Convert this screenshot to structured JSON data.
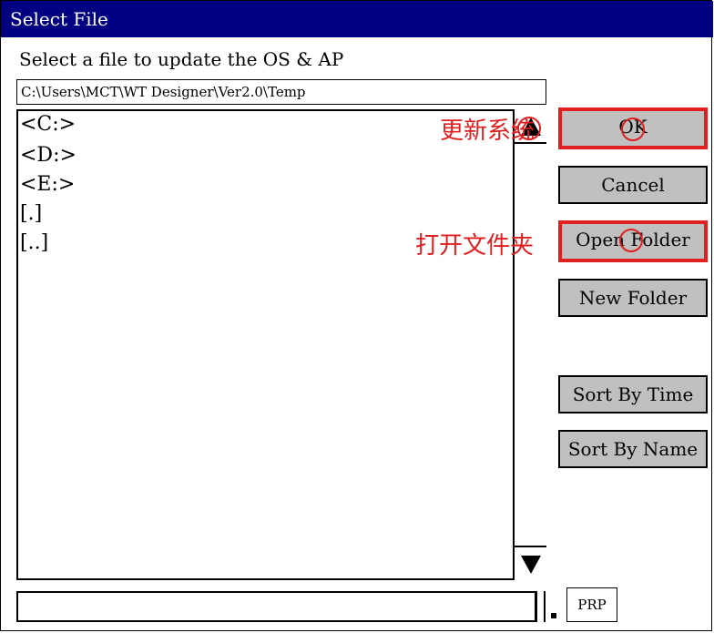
{
  "window": {
    "title": "Select File"
  },
  "subtitle": "Select a file to update the OS & AP",
  "path": "C:\\Users\\MCT\\WT Designer\\Ver2.0\\Temp",
  "file_list": {
    "items": [
      "<C:>",
      "<D:>",
      "<E:>",
      "[.]",
      "[..]"
    ]
  },
  "buttons": {
    "ok": "OK",
    "cancel": "Cancel",
    "open_folder": "Open Folder",
    "new_folder": "New Folder",
    "sort_time": "Sort By Time",
    "sort_name": "Sort By Name"
  },
  "annotations": {
    "update_system": "更新系统",
    "open_folder": "打开文件夹"
  },
  "filename": {
    "value": "",
    "extension": "PRP"
  },
  "colors": {
    "titlebar": "#000080",
    "button": "#c0c0c0",
    "annotation": "#e02020"
  },
  "icons": {
    "scroll_up": "triangle-up-icon",
    "scroll_down": "triangle-down-icon"
  }
}
